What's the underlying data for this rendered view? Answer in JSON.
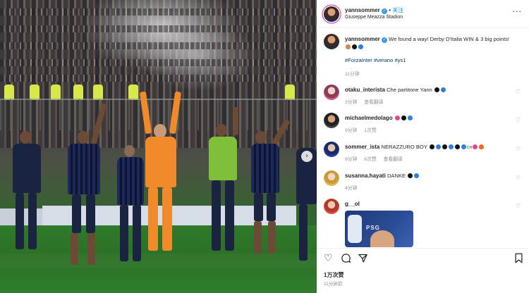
{
  "post": {
    "author": "yannsommer",
    "follow_label": "关注",
    "location": "Giuseppe Meazza Stadion",
    "caption_text": "We found a way! Derby D'Italia WIN & 3 big points!",
    "caption_hashtags": "#ForzaInter #verano #ys1",
    "caption_time": "11分钟",
    "likes": "1万次赞",
    "posted_ago": "11分钟前"
  },
  "comments": [
    {
      "username": "otaku_interista",
      "text": "Che partitone Yann",
      "time": "3分钟",
      "reply_label": "查看翻译",
      "likes": ""
    },
    {
      "username": "michaelmedolago",
      "text": "",
      "time": "9分钟",
      "reply_label": "",
      "likes": "1次赞"
    },
    {
      "username": "sommer_ista",
      "text": "NERAZZURO BOY",
      "time": "9分钟",
      "reply_label": "查看翻译",
      "likes": "6次赞"
    },
    {
      "username": "susanna.hayati",
      "text": "DANKE",
      "time": "4分钟",
      "reply_label": "",
      "likes": ""
    },
    {
      "username": "g__ol",
      "text": "",
      "time": "",
      "reply_label": "",
      "likes": ""
    }
  ],
  "gif": {
    "brand_text": "PSG"
  },
  "icons": {
    "more": "more-icon",
    "heart": "heart-icon",
    "comment": "comment-icon",
    "share": "share-icon",
    "bookmark": "bookmark-icon",
    "next": "chevron-right-icon",
    "verified": "verified-badge-icon"
  },
  "colors": {
    "accent": "#0095f6",
    "verified": "#3897f0",
    "hashtag": "#00376b"
  }
}
